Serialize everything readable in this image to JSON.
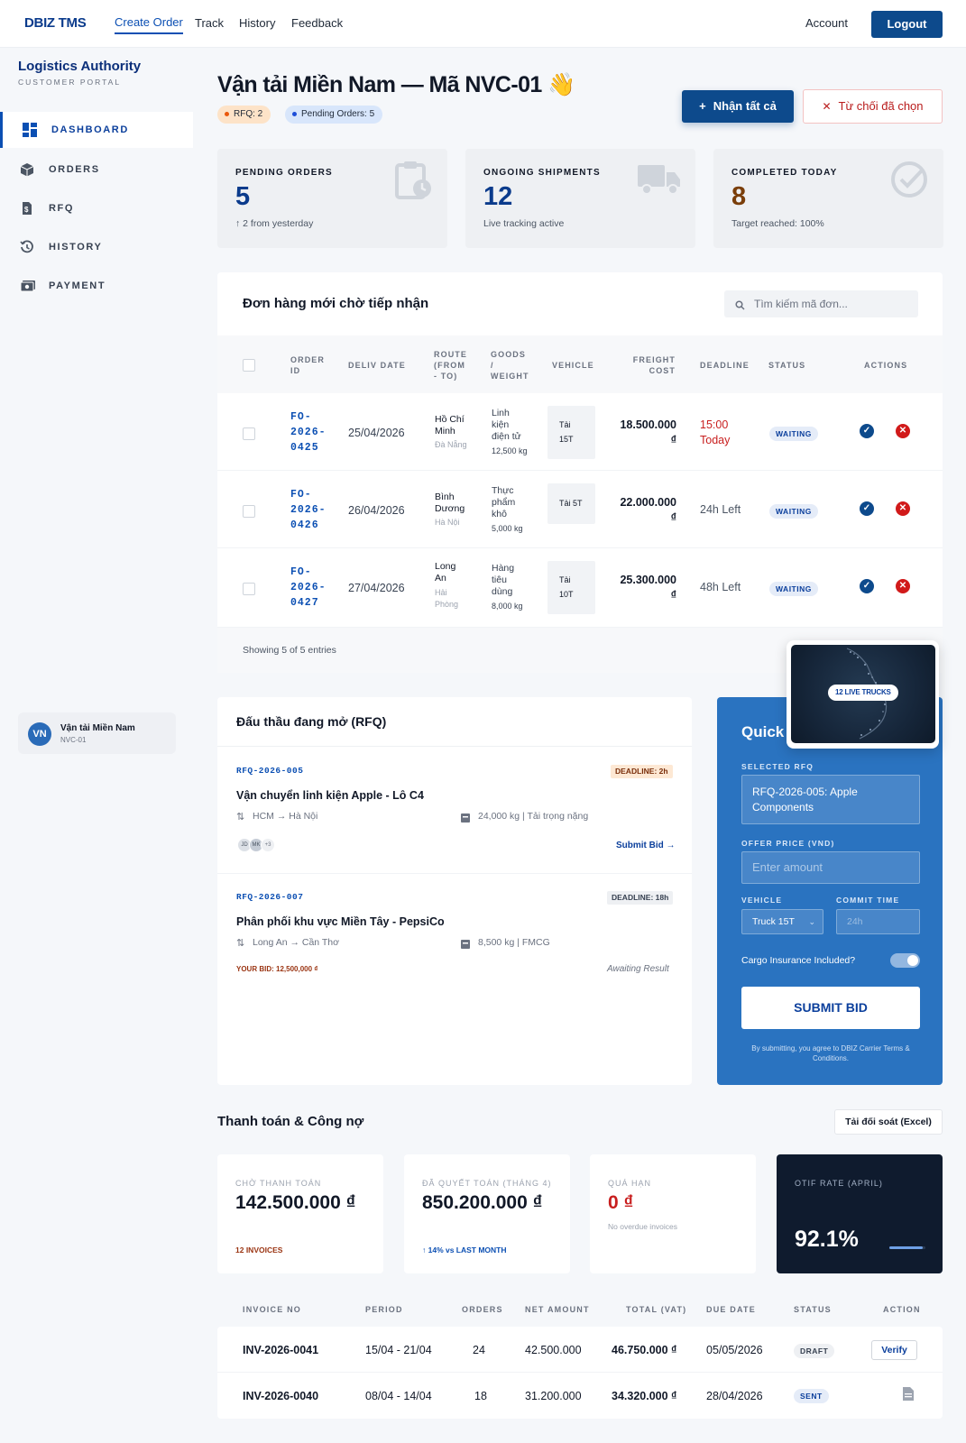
{
  "nav": {
    "brand": "DBIZ TMS",
    "links": [
      "Create Order",
      "Track",
      "History",
      "Feedback"
    ],
    "account": "Account",
    "logout": "Logout"
  },
  "sidebar": {
    "title": "Logistics Authority",
    "subtitle": "CUSTOMER PORTAL",
    "items": [
      {
        "label": "DASHBOARD",
        "icon": "dashboard-icon",
        "active": true
      },
      {
        "label": "ORDERS",
        "icon": "box-icon"
      },
      {
        "label": "RFQ",
        "icon": "invoice-dollar-icon"
      },
      {
        "label": "HISTORY",
        "icon": "history-icon"
      },
      {
        "label": "PAYMENT",
        "icon": "payment-icon"
      }
    ],
    "user": {
      "initials": "VN",
      "name": "Vận tải Miền Nam",
      "code": "NVC-01"
    }
  },
  "header": {
    "title": "Vận tải Miền Nam — Mã NVC-01 👋",
    "badge_rfq": "RFQ: 2",
    "badge_pending": "Pending Orders: 5",
    "accept_all": "Nhận tất cả",
    "reject_selected": "Từ chối đã chọn"
  },
  "stats": [
    {
      "title": "PENDING ORDERS",
      "value": "5",
      "sub": "↑ 2 from yesterday",
      "icon": "clipboard-clock-icon"
    },
    {
      "title": "ONGOING SHIPMENTS",
      "value": "12",
      "sub": "Live tracking active",
      "icon": "truck-icon"
    },
    {
      "title": "COMPLETED TODAY",
      "value": "8",
      "sub": "Target reached: 100%",
      "icon": "check-circle-icon"
    }
  ],
  "orders": {
    "title": "Đơn hàng mới chờ tiếp nhận",
    "search_placeholder": "Tìm kiếm mã đơn...",
    "headers": {
      "order_id": [
        "ORDER",
        "ID"
      ],
      "deliv_date": "DELIV DATE",
      "route": [
        "ROUTE",
        "(FROM",
        "- TO)"
      ],
      "goods": [
        "GOODS",
        "/",
        "WEIGHT"
      ],
      "vehicle": "VEHICLE",
      "freight": [
        "FREIGHT",
        "COST"
      ],
      "deadline": "DEADLINE",
      "status": "STATUS",
      "actions": "ACTIONS"
    },
    "rows": [
      {
        "id": [
          "FO-",
          "2026-",
          "0425"
        ],
        "date": "25/04/2026",
        "from": [
          "Hồ Chí",
          "Minh"
        ],
        "to": [
          "Đà Nẵng"
        ],
        "goods": [
          "Linh",
          "kiện",
          "điện tử"
        ],
        "weight": "12,500 kg",
        "vehicle": [
          "Tải",
          "15T"
        ],
        "cost": [
          "18.500.000",
          "₫"
        ],
        "deadline": [
          "15:00",
          "Today"
        ],
        "status": "WAITING"
      },
      {
        "id": [
          "FO-",
          "2026-",
          "0426"
        ],
        "date": "26/04/2026",
        "from": [
          "Bình",
          "Dương"
        ],
        "to": [
          "Hà Nội"
        ],
        "goods": [
          "Thực",
          "phẩm",
          "khô"
        ],
        "weight": "5,000 kg",
        "vehicle": [
          "Tải 5T"
        ],
        "cost": [
          "22.000.000",
          "₫"
        ],
        "deadline": [
          "24h Left"
        ],
        "status": "WAITING"
      },
      {
        "id": [
          "FO-",
          "2026-",
          "0427"
        ],
        "date": "27/04/2026",
        "from": [
          "Long",
          "An"
        ],
        "to": [
          "Hải",
          "Phòng"
        ],
        "goods": [
          "Hàng",
          "tiêu",
          "dùng"
        ],
        "weight": "8,000 kg",
        "vehicle": [
          "Tải",
          "10T"
        ],
        "cost": [
          "25.300.000",
          "₫"
        ],
        "deadline": [
          "48h Left"
        ],
        "status": "WAITING"
      }
    ],
    "footer": "Showing 5 of 5 entries"
  },
  "map_badge": "12 LIVE TRUCKS",
  "rfq": {
    "title": "Đấu thầu đang mở (RFQ)",
    "items": [
      {
        "code": "RFQ-2026-005",
        "deadline": "DEADLINE: 2h",
        "title": "Vận chuyển linh kiện Apple - Lô C4",
        "route": "HCM → Hà Nội",
        "weight": "24,000 kg | Tải trọng nặng",
        "avatars": [
          "JD",
          "MK",
          "+3"
        ],
        "action": "Submit Bid →"
      },
      {
        "code": "RFQ-2026-007",
        "deadline": "DEADLINE: 18h",
        "title": "Phân phối khu vực Miền Tây - PepsiCo",
        "route": "Long An → Cần Thơ",
        "weight": "8,500 kg | FMCG",
        "your_bid": "YOUR BID: 12,500,000 ₫",
        "action": "Awaiting Result"
      }
    ]
  },
  "quick_bid": {
    "title": "Quick",
    "selected_label": "SELECTED RFQ",
    "selected_value": "RFQ-2026-005: Apple Components",
    "price_label": "OFFER PRICE (VND)",
    "price_placeholder": "Enter amount",
    "vehicle_label": "VEHICLE",
    "vehicle_value": "Truck 15T",
    "commit_label": "COMMIT TIME",
    "commit_placeholder": "24h",
    "insurance_label": "Cargo Insurance Included?",
    "insurance_on": true,
    "submit": "SUBMIT BID",
    "terms": "By submitting, you agree to DBIZ Carrier Terms & Conditions."
  },
  "finance": {
    "title": "Thanh toán & Công nợ",
    "download": "Tải đối soát (Excel)",
    "cards": [
      {
        "title": "CHỜ THANH TOÁN",
        "value": "142.500.000 ₫",
        "sub": "12 INVOICES",
        "sub_color": "#9a3412"
      },
      {
        "title": "ĐÃ QUYẾT TOÁN (THÁNG 4)",
        "value": "850.200.000 ₫",
        "sub": "↑ 14% vs LAST MONTH",
        "sub_color": "#0b4fb3"
      },
      {
        "title": "QUÁ HẠN",
        "value": "0 ₫",
        "sub": "No overdue invoices",
        "sub_color": "#9ca3af"
      }
    ],
    "otif": {
      "title": "OTIF RATE (APRIL)",
      "value": "92.1%",
      "progress": 0.921
    },
    "headers": [
      "INVOICE NO",
      "PERIOD",
      "ORDERS",
      "NET AMOUNT",
      "TOTAL (VAT)",
      "DUE DATE",
      "STATUS",
      "ACTION"
    ],
    "invoices": [
      {
        "no": "INV-2026-0041",
        "period": "15/04 - 21/04",
        "orders": "24",
        "net": "42.500.000",
        "total": "46.750.000 ₫",
        "due": "05/05/2026",
        "status": "DRAFT",
        "action": "Verify"
      },
      {
        "no": "INV-2026-0040",
        "period": "08/04 - 14/04",
        "orders": "18",
        "net": "31.200.000",
        "total": "34.320.000 ₫",
        "due": "28/04/2026",
        "status": "SENT",
        "action": "document-icon"
      }
    ]
  }
}
